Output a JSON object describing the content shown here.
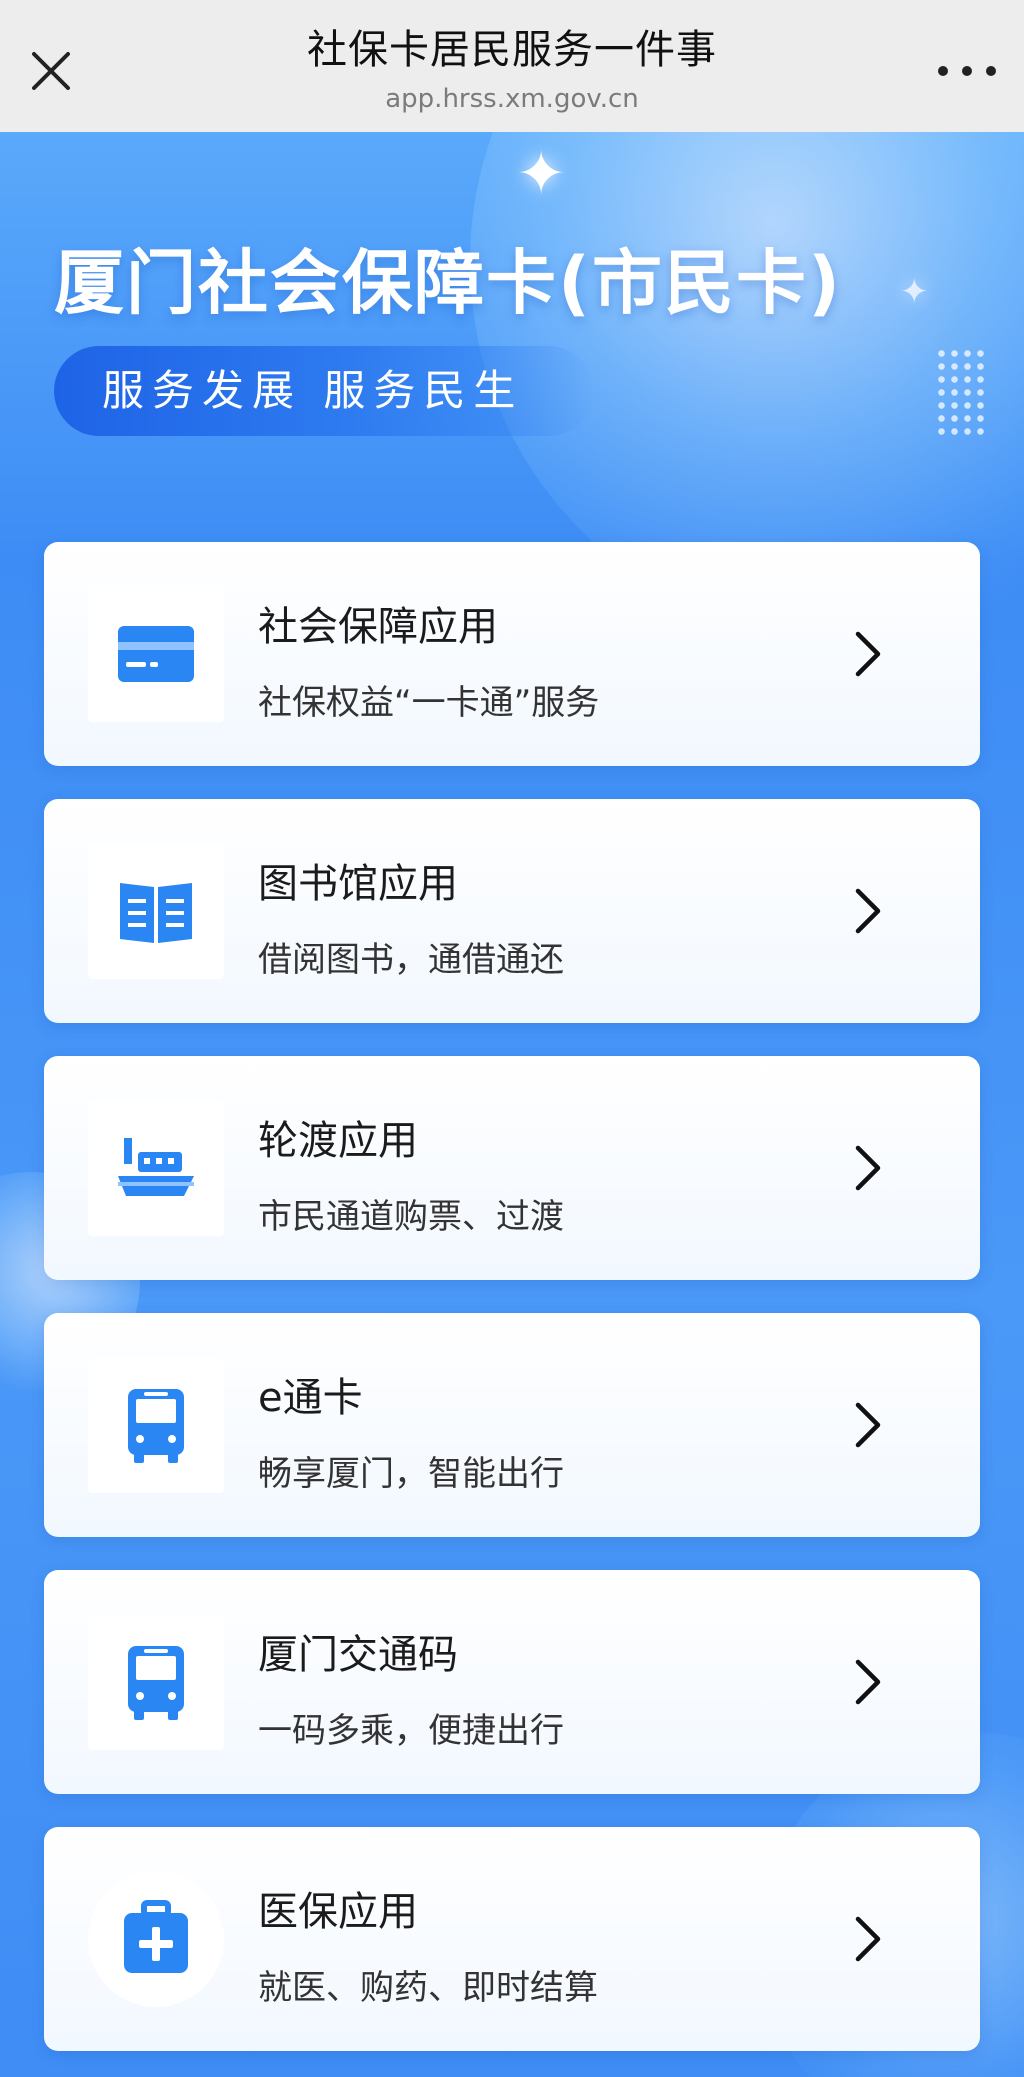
{
  "topbar": {
    "title": "社保卡居民服务一件事",
    "url": "app.hrss.xm.gov.cn",
    "close_icon": "close-icon",
    "more_icon": "more-dots-icon"
  },
  "hero": {
    "title": "厦门社会保障卡(市民卡)",
    "slogan": "服务发展 服务民生"
  },
  "colors": {
    "accent": "#3f8df5",
    "icon_blue": "#2a86f2",
    "slogan_blue": "#1e63e6"
  },
  "cards": [
    {
      "title": "社会保障应用",
      "subtitle": "社保权益“一卡通”服务",
      "icon": "card-icon"
    },
    {
      "title": "图书馆应用",
      "subtitle": "借阅图书，通借通还",
      "icon": "book-icon"
    },
    {
      "title": "轮渡应用",
      "subtitle": "市民通道购票、过渡",
      "icon": "ferry-icon"
    },
    {
      "title": "e通卡",
      "subtitle": "畅享厦门，智能出行",
      "icon": "bus-icon"
    },
    {
      "title": "厦门交通码",
      "subtitle": "一码多乘，便捷出行",
      "icon": "bus-icon"
    },
    {
      "title": "医保应用",
      "subtitle": "就医、购药、即时结算",
      "icon": "medical-kit-icon"
    }
  ]
}
